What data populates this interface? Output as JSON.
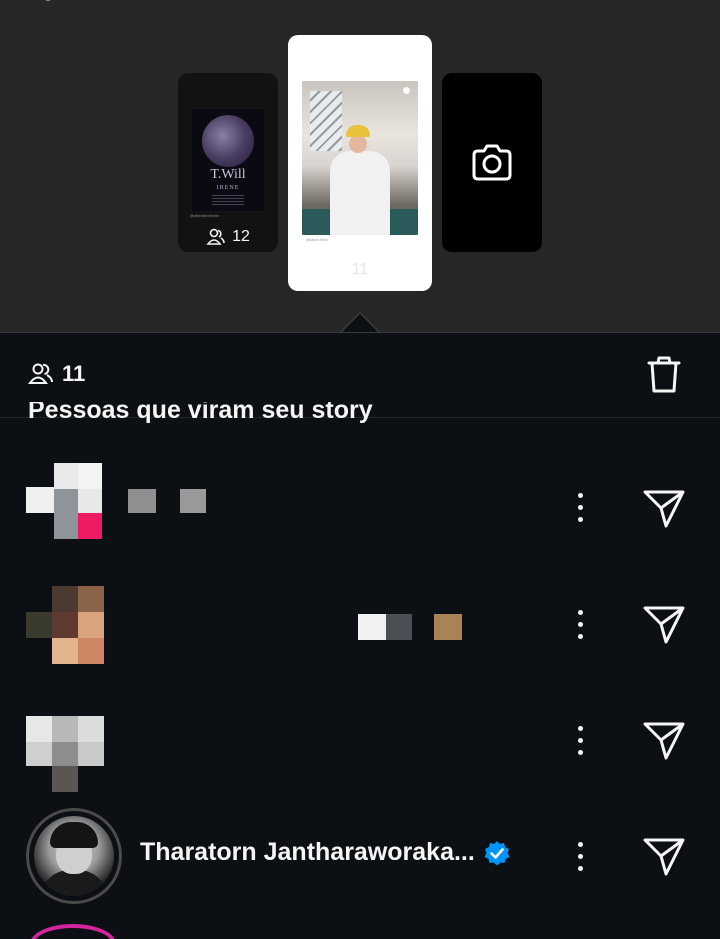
{
  "stories": {
    "left": {
      "count": "12",
      "poster_title": "T.Will",
      "poster_subtitle": "IRENE",
      "handle": "@afterlifeofirene"
    },
    "center": {
      "count": "11",
      "handle": "@taem.bbm"
    },
    "right": {
      "icon": "camera-icon"
    }
  },
  "viewers": {
    "count": "11",
    "section_title": "Pessoas que viram seu story"
  },
  "list": [
    {
      "type": "pixelated"
    },
    {
      "type": "pixelated"
    },
    {
      "type": "pixelated"
    },
    {
      "type": "user",
      "name": "Tharatorn Jantharaworaka...",
      "verified": true
    }
  ],
  "colors": {
    "background": "#0c1014",
    "top_area": "#262626",
    "verified": "#0095f6",
    "text": "#f5f5f5"
  }
}
